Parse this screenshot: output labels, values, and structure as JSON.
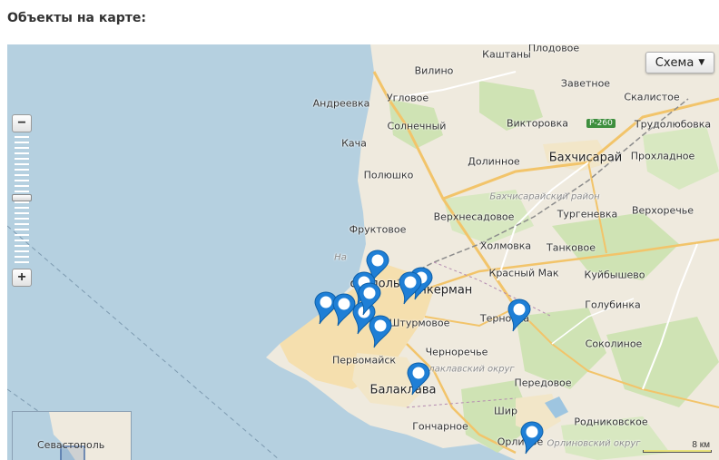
{
  "heading": "Объекты на карте:",
  "map_type_button": "Схема",
  "zoom": {
    "plus_label": "+",
    "minus_label": "−"
  },
  "scale_label": "8 км",
  "minimap_label": "Севастополь",
  "labels": {
    "plodovoe": "Плодовое",
    "kashtany": "Каштаны",
    "vilino": "Вилино",
    "zavetnoe": "Заветное",
    "skalistoe": "Скалистое",
    "andreevka": "Андреевка",
    "uglovoe": "Угловое",
    "viktorovka": "Викторовка",
    "road": "Р-260",
    "trudolyubovka": "Трудолюбовка",
    "solnechny": "Солнечный",
    "kacha": "Кача",
    "dolinnoe": "Долинное",
    "bakhchisaray": "Бахчисарай",
    "prokhladnoe": "Прохладное",
    "polyushko": "Полюшко",
    "bakh_region": "Бахчисарайский район",
    "verkhnesadovoe": "Верхнесадовое",
    "turgenevka": "Тургеневка",
    "verkhorechye": "Верхоречье",
    "fruktovoe": "Фруктовое",
    "kholmovka": "Холмовка",
    "tankovoe": "Танковое",
    "nakhim_partial": "На",
    "krasny_mak": "Красный Мак",
    "kuibyshevo": "Куйбышево",
    "sevastopol_partial": "стополь",
    "inkerman": "Инкерман",
    "golubinka": "Голубинка",
    "shturmovoe": "Штурмовое",
    "ternovka": "Терновка",
    "chernorechye": "Черноречье",
    "sokolinoe": "Соколиное",
    "pervomayskoe": "Первомайск",
    "balaklava_region": "Балаклавский округ",
    "peredovoe": "Передовое",
    "balaklava": "Балаклава",
    "shirokoe_partial": "Шир",
    "goncharnoe": "Гончарное",
    "rodnikovskoe": "Родниковское",
    "orlinoe": "Орлиное",
    "orlinoe_region": "Орлиновский округ"
  },
  "colors": {
    "sea": "#b5d0e0",
    "land": "#efeade",
    "forest": "#cfe3b4",
    "city": "#f5dfae",
    "road": "#f2c46a",
    "pin": "#1f7fd6"
  },
  "pins": [
    "marker-1",
    "marker-2",
    "marker-3",
    "marker-4",
    "marker-5",
    "marker-6",
    "marker-7",
    "marker-8",
    "marker-9",
    "marker-10",
    "marker-11",
    "marker-12"
  ]
}
